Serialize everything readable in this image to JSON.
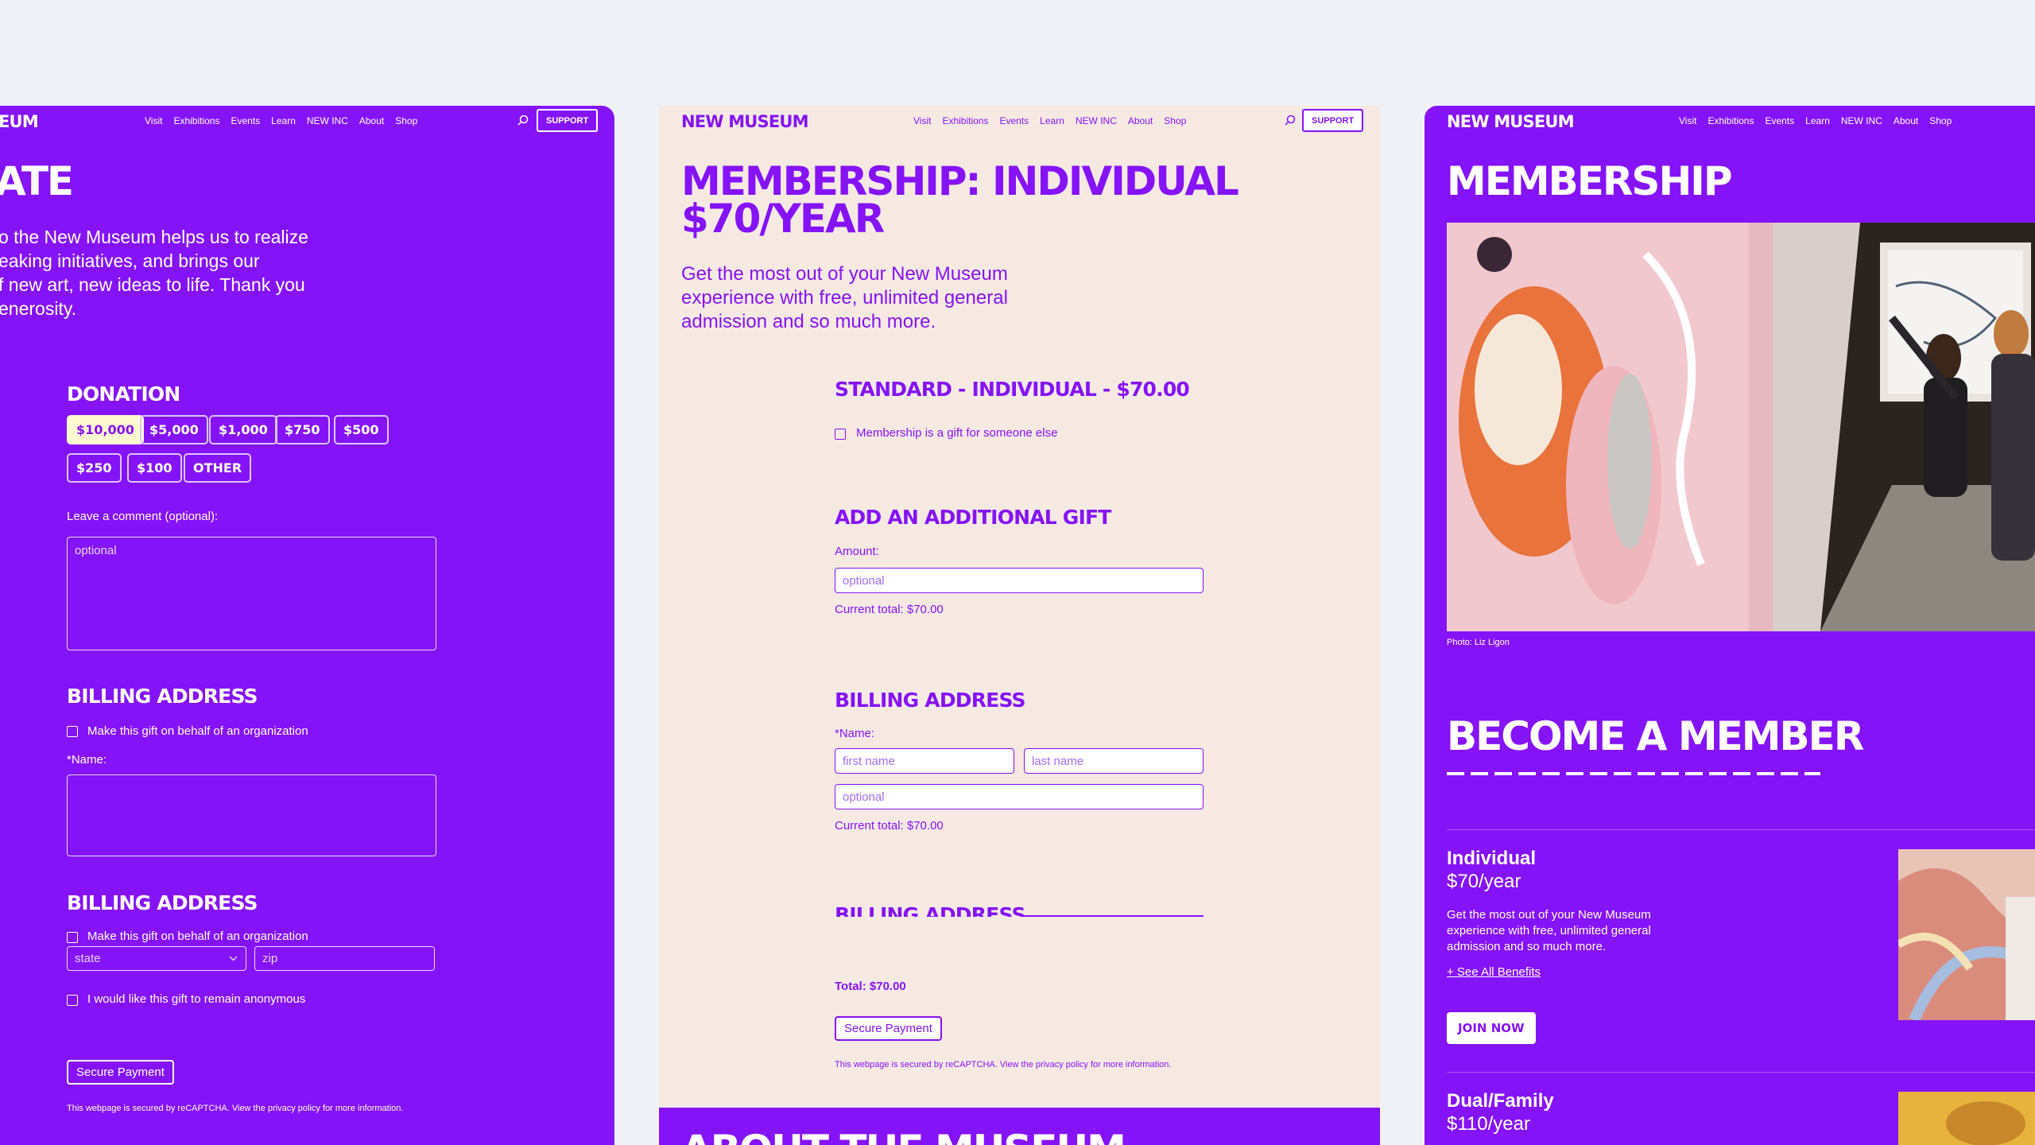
{
  "nav": {
    "links": [
      "Visit",
      "Exhibitions",
      "Events",
      "Learn",
      "NEW INC",
      "About",
      "Shop"
    ],
    "support": "SUPPORT",
    "logo": "NEW MUSEUM",
    "logo_clipped": "EUM"
  },
  "left": {
    "title_clipped": "ATE",
    "intro_lines": [
      "o the New Museum helps us to realize",
      "eaking initiatives, and brings our",
      "f new art, new ideas to life. Thank you",
      "enerosity."
    ],
    "donation_heading": "DONATION",
    "amounts_row1": [
      "$10,000",
      "$5,000",
      "$1,000",
      "$750",
      "$500"
    ],
    "amounts_row2": [
      "$250",
      "$100",
      "OTHER"
    ],
    "comment_label": "Leave a comment (optional):",
    "comment_placeholder": "optional",
    "billing_heading": "BILLING ADDRESS",
    "org_check_label": "Make this gift on behalf of an organization",
    "name_label": "*Name:",
    "billing_heading_2": "BILLING ADDRESS",
    "org_check_label_2": "Make this gift on behalf of an organization",
    "state_placeholder": "state",
    "zip_placeholder": "zip",
    "anon_label": "I would like this gift to remain anonymous",
    "secure_payment": "Secure Payment",
    "recaptcha": "This webpage is secured by reCAPTCHA. View the privacy policy for more information."
  },
  "mid": {
    "title_line1": "MEMBERSHIP: INDIVIDUAL",
    "title_line2": "$70/YEAR",
    "lede_lines": [
      "Get the most out of your New Museum",
      "experience with free, unlimited general",
      "admission and so much more."
    ],
    "standard_heading": "STANDARD - INDIVIDUAL - $70.00",
    "gift_check_label": "Membership is a gift for someone else",
    "additional_heading": "ADD AN ADDITIONAL GIFT",
    "amount_label": "Amount:",
    "amount_placeholder": "optional",
    "current_total": "Current total: $70.00",
    "billing_heading": "BILLING ADDRESS",
    "name_label": "*Name:",
    "first_placeholder": "first name",
    "last_placeholder": "last name",
    "optional_placeholder": "optional",
    "current_total_2": "Current total: $70.00",
    "billing_heading_3": "BILLING ADDRESS",
    "total": "Total: $70.00",
    "secure_payment": "Secure Payment",
    "recaptcha": "This webpage is secured by reCAPTCHA. View the privacy policy for more information.",
    "footer_title": "ABOUT THE MUSEUM"
  },
  "right": {
    "title": "MEMBERSHIP",
    "photo_credit": "Photo: Liz Ligon",
    "become_heading": "BECOME A MEMBER",
    "tier1_name": "Individual",
    "tier1_price": "$70/year",
    "tier1_desc_lines": [
      "Get the most out of your New Museum",
      "experience with free, unlimited general",
      "admission and so much more."
    ],
    "see_benefits": "+ See All Benefits",
    "join_now": "JOIN NOW",
    "tier2_name": "Dual/Family",
    "tier2_price": "$110/year"
  },
  "colors": {
    "brand_purple": "#8513f7",
    "cream": "#f6e9e2",
    "selected_amount": "#fffbd0",
    "background": "#eef2f7"
  }
}
